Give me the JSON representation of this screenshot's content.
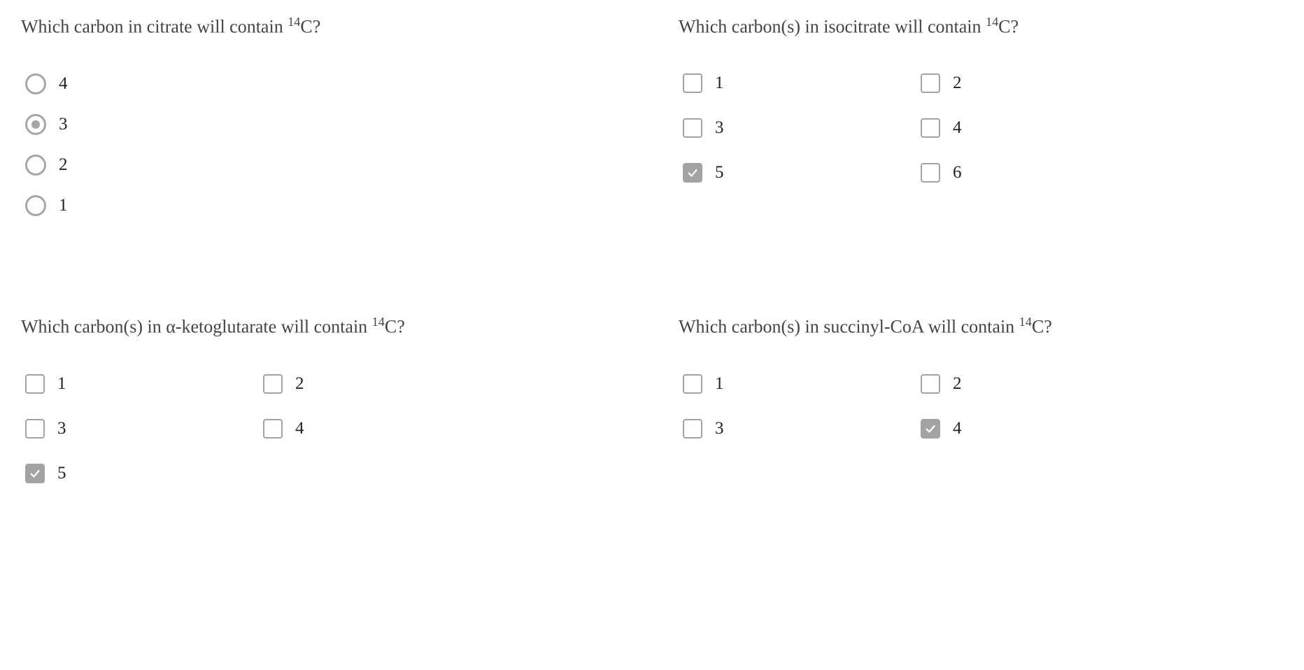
{
  "questions": [
    {
      "prompt_pre": "Which carbon in citrate will contain ",
      "prompt_sup": "14",
      "prompt_post": "C?",
      "type": "radio",
      "cols": 1,
      "options": [
        {
          "label": "4",
          "selected": false
        },
        {
          "label": "3",
          "selected": true
        },
        {
          "label": "2",
          "selected": false
        },
        {
          "label": "1",
          "selected": false
        }
      ]
    },
    {
      "prompt_pre": "Which carbon(s) in isocitrate will contain ",
      "prompt_sup": "14",
      "prompt_post": "C?",
      "type": "checkbox",
      "cols": 2,
      "options": [
        {
          "label": "1",
          "selected": false
        },
        {
          "label": "2",
          "selected": false
        },
        {
          "label": "3",
          "selected": false
        },
        {
          "label": "4",
          "selected": false
        },
        {
          "label": "5",
          "selected": true
        },
        {
          "label": "6",
          "selected": false
        }
      ]
    },
    {
      "prompt_pre": "Which carbon(s) in α-ketoglutarate will contain ",
      "prompt_sup": "14",
      "prompt_post": "C?",
      "type": "checkbox",
      "cols": 2,
      "options": [
        {
          "label": "1",
          "selected": false
        },
        {
          "label": "2",
          "selected": false
        },
        {
          "label": "3",
          "selected": false
        },
        {
          "label": "4",
          "selected": false
        },
        {
          "label": "5",
          "selected": true
        }
      ]
    },
    {
      "prompt_pre": "Which carbon(s) in succinyl-CoA will contain ",
      "prompt_sup": "14",
      "prompt_post": "C?",
      "type": "checkbox",
      "cols": 2,
      "options": [
        {
          "label": "1",
          "selected": false
        },
        {
          "label": "2",
          "selected": false
        },
        {
          "label": "3",
          "selected": false
        },
        {
          "label": "4",
          "selected": true
        }
      ]
    }
  ]
}
